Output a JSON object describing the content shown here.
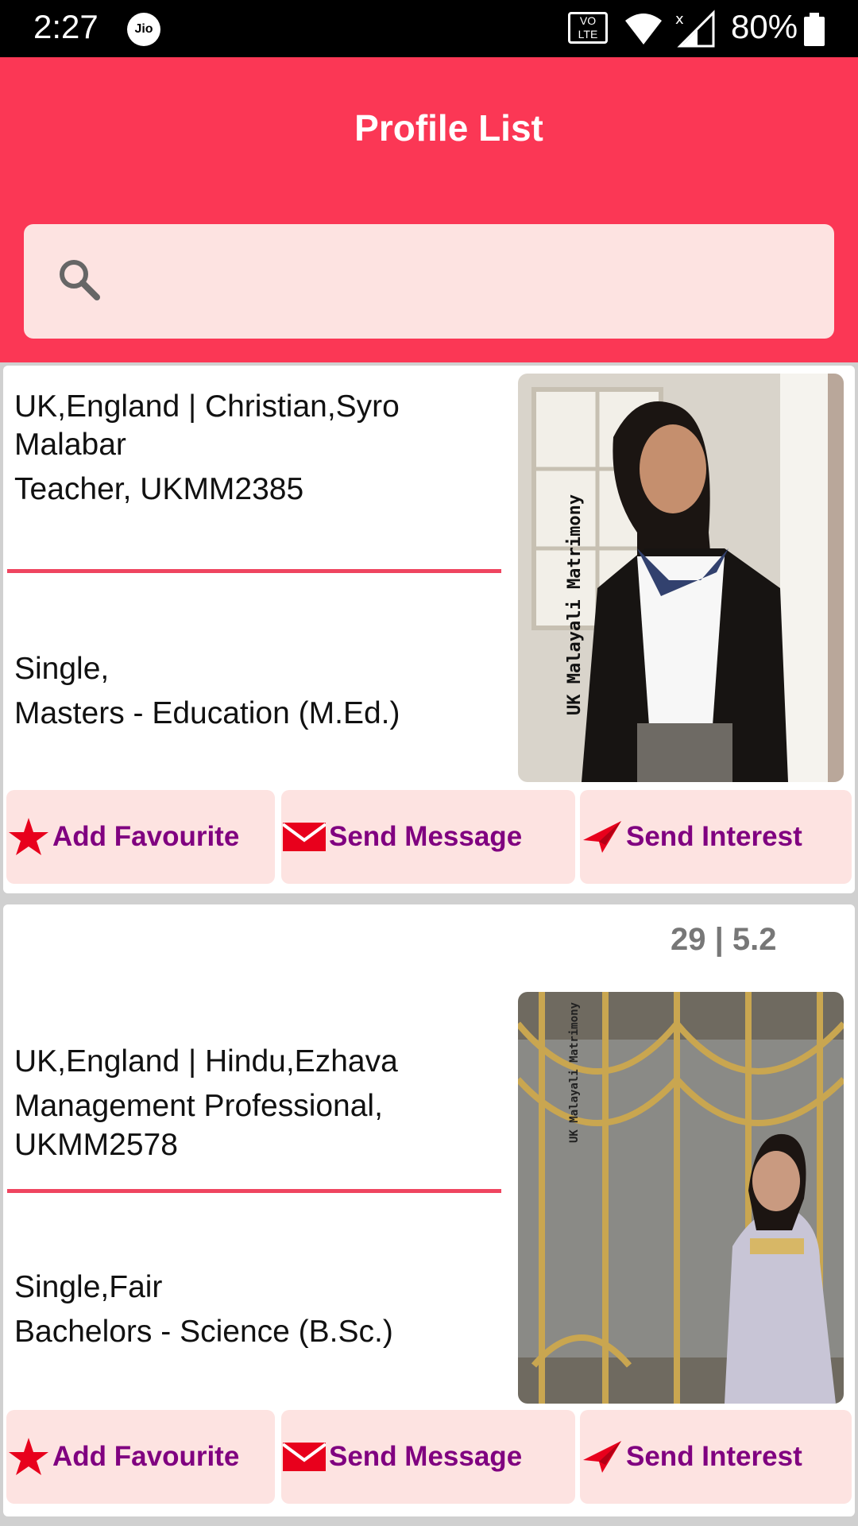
{
  "status_bar": {
    "time": "2:27",
    "carrier_badge": "Jio",
    "volte": [
      "VO",
      "LTE"
    ],
    "battery": "80%"
  },
  "header": {
    "title": "Profile List",
    "search_placeholder": ""
  },
  "colors": {
    "header": "#fb3755",
    "search_bg": "#fde3e1",
    "button_bg": "#fde3e1",
    "button_text": "#800080",
    "divider": "#ef4560",
    "star": "#e8001c"
  },
  "profiles": [
    {
      "age_height": "",
      "location_religion": "UK,England | Christian,Syro",
      "location_religion_cont": "Malabar",
      "job_id": "Teacher, UKMM2385",
      "job_id_cont": "",
      "status": "Single,",
      "education": "Masters - Education (M.Ed.)",
      "watermark": "UK Malayali Matrimony",
      "actions": {
        "favourite": "Add Favourite",
        "message": "Send Message",
        "interest": "Send Interest"
      }
    },
    {
      "age_height": "29 | 5.2",
      "location_religion": "UK,England | Hindu,Ezhava",
      "location_religion_cont": "",
      "job_id": "Management Professional,",
      "job_id_cont": "UKMM2578",
      "status": "Single,Fair",
      "education": "Bachelors - Science (B.Sc.)",
      "watermark": "UK Malayali Matrimony",
      "actions": {
        "favourite": "Add Favourite",
        "message": "Send Message",
        "interest": "Send Interest"
      }
    }
  ]
}
